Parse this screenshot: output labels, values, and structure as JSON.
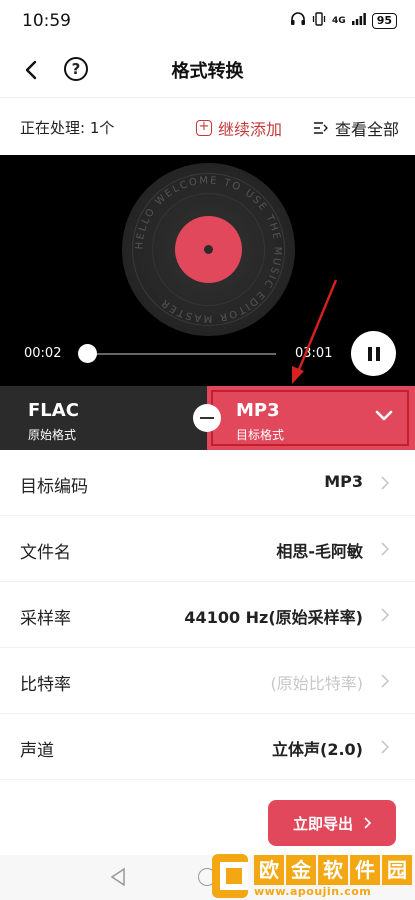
{
  "status": {
    "time": "10:59",
    "network": "4G",
    "battery": "95"
  },
  "header": {
    "title": "格式转换"
  },
  "processing": {
    "label": "正在处理: 1个",
    "add_more": "继续添加",
    "view_all": "查看全部"
  },
  "player": {
    "current_time": "00:02",
    "total_time": "03:01",
    "progress": 0.01,
    "disc_text": "HELLO WELCOME TO USE THE MUSIC EDITOR MASTER"
  },
  "format": {
    "source": {
      "name": "FLAC",
      "label": "原始格式"
    },
    "target": {
      "name": "MP3",
      "label": "目标格式"
    }
  },
  "settings": [
    {
      "label": "目标编码",
      "value": "MP3"
    },
    {
      "label": "文件名",
      "value": "相思-毛阿敏"
    },
    {
      "label": "采样率",
      "value": "44100 Hz(原始采样率)"
    },
    {
      "label": "比特率",
      "value": "(原始比特率)"
    },
    {
      "label": "声道",
      "value": "立体声(2.0)"
    }
  ],
  "export": {
    "label": "立即导出"
  },
  "watermark": {
    "title": [
      "欧",
      "金",
      "软",
      "件",
      "园"
    ],
    "url": "www.apoujin.com"
  },
  "colors": {
    "accent": "#e1485c",
    "highlight": "#c41e2f",
    "dark_panel": "#2b2b2b"
  }
}
